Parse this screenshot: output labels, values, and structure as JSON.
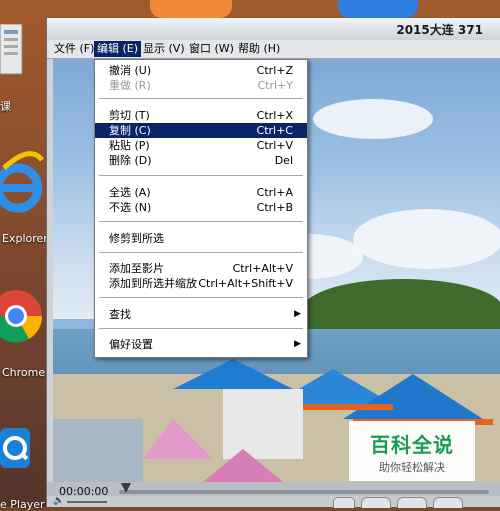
{
  "desktop": {
    "icons": [
      {
        "name": "document-icon",
        "label": "课"
      },
      {
        "name": "internet-explorer-icon",
        "label": "Explorer"
      },
      {
        "name": "chrome-icon",
        "label": "Chrome"
      },
      {
        "name": "quicktime-icon",
        "label": "e Player"
      }
    ]
  },
  "window": {
    "title": "2015大连 371"
  },
  "menubar": [
    {
      "label": "文件 (F)"
    },
    {
      "label": "编辑 (E)"
    },
    {
      "label": "显示 (V)"
    },
    {
      "label": "窗口 (W)"
    },
    {
      "label": "帮助 (H)"
    }
  ],
  "edit_menu": {
    "items": [
      {
        "label": "撤消 (U)",
        "shortcut": "Ctrl+Z"
      },
      {
        "label": "重做 (R)",
        "shortcut": "Ctrl+Y"
      },
      {
        "label": "剪切 (T)",
        "shortcut": "Ctrl+X"
      },
      {
        "label": "复制 (C)",
        "shortcut": "Ctrl+C"
      },
      {
        "label": "粘贴 (P)",
        "shortcut": "Ctrl+V"
      },
      {
        "label": "删除 (D)",
        "shortcut": "Del"
      },
      {
        "label": "全选 (A)",
        "shortcut": "Ctrl+A"
      },
      {
        "label": "不选 (N)",
        "shortcut": "Ctrl+B"
      },
      {
        "label": "修剪到所选",
        "shortcut": ""
      },
      {
        "label": "添加至影片",
        "shortcut": "Ctrl+Alt+V"
      },
      {
        "label": "添加到所选并缩放",
        "shortcut": "Ctrl+Alt+Shift+V"
      },
      {
        "label": "查找",
        "shortcut": ""
      },
      {
        "label": "偏好设置",
        "shortcut": ""
      }
    ]
  },
  "controls": {
    "timecode": "00:00:00"
  },
  "watermark": {
    "title": "百科全说",
    "subtitle": "助你轻松解决"
  },
  "colors": {
    "menu_highlight": "#0a246a",
    "watermark_green": "#1c9a52"
  }
}
